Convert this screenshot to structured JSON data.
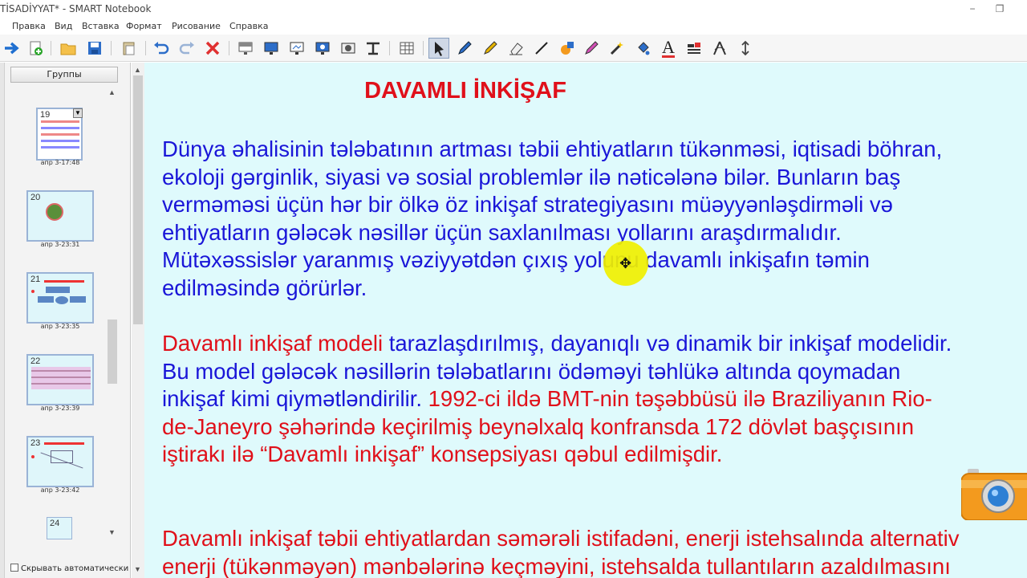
{
  "window": {
    "title": "TİSADİYYAT* - SMART Notebook",
    "minimize_glyph": "−",
    "restore_glyph": "❐"
  },
  "menu": [
    "Правка",
    "Вид",
    "Вставка",
    "Формат",
    "Рисование",
    "Справка"
  ],
  "toolbar": {
    "icons": [
      "next-page-icon",
      "add-page-icon",
      "open-folder-icon",
      "save-icon",
      "paste-icon",
      "undo-icon",
      "redo-icon",
      "delete-icon",
      "screen-shade-icon",
      "full-screen-icon",
      "transparent-background-icon",
      "document-camera-icon",
      "capture-icon",
      "table-icon",
      "select-arrow-icon",
      "pen-icon",
      "creative-pen-icon",
      "eraser-icon",
      "line-icon",
      "shapes-icon",
      "magic-pen-icon",
      "shape-recognition-pen-icon",
      "fill-icon",
      "text-icon",
      "properties-icon",
      "measurement-icon",
      "move-toolbar-icon"
    ],
    "text_tool_letter": "A"
  },
  "sidebar": {
    "groups_label": "Группы",
    "thumbnails": [
      {
        "num": "19",
        "time": "апр 3-17:48"
      },
      {
        "num": "20",
        "time": "апр 3-23:31"
      },
      {
        "num": "21",
        "time": "апр 3-23:35"
      },
      {
        "num": "22",
        "time": "апр 3-23:39"
      },
      {
        "num": "23",
        "time": "апр 3-23:42"
      },
      {
        "num": "24",
        "time": ""
      }
    ],
    "autohide_label": "Скрывать автоматически"
  },
  "slide": {
    "title": "DAVAMLI İNKİŞAF",
    "p1": [
      "Dünya əhalisinin tələbatının artması təbii ehtiyatların tükənməsi, iqtisadi böhran,",
      "ekoloji gərginlik, siyasi və sosial problemlər ilə nəticələnə bilər. Bunların baş",
      "verməməsi üçün hər bir ölkə öz inkişaf strategiyasını müəyyənləşdirməli və",
      "ehtiyatların gələcək nəsillər üçün saxlanılması yollarını araşdırmalıdır.",
      "Mütəxəssislər yaranmış vəziyyətdən çıxış yolunu davamlı inkişafın təmin",
      "edilməsində görürlər."
    ],
    "p2": {
      "l1_red": "Davamlı inkişaf modeli",
      "l1_blue": " tarazlaşdırılmış, dayanıqlı və dinamik bir inkişaf modelidir.",
      "l2": "Bu model gələcək nəsillərin tələbatlarını ödəməyi təhlükə altında qoymadan",
      "l3_blue": "inkişaf kimi qiymətləndirilir.",
      "l3_red": " 1992-ci ildə BMT-nin təşəbbüsü ilə Braziliyanın Rio-",
      "l4": "de-Janeyro şəhərində keçirilmiş beynəlxalq konfransda 172 dövlət başçısının",
      "l5": "iştirakı ilə “Davamlı inkişaf” konsepsiyası qəbul edilmişdir."
    },
    "p3": [
      "Davamlı inkişaf təbii ehtiyatlardan səmərəli istifadəni, enerji istehsalında alternativ",
      "enerji (tükənməyən) mənbələrinə keçməyini, istehsalda tullantıların azaldılmasını"
    ]
  },
  "colors": {
    "canvas_bg": "#dffafc",
    "title_red": "#e0101a",
    "text_blue": "#1a16d8",
    "highlight_yellow": "#f0f000"
  }
}
